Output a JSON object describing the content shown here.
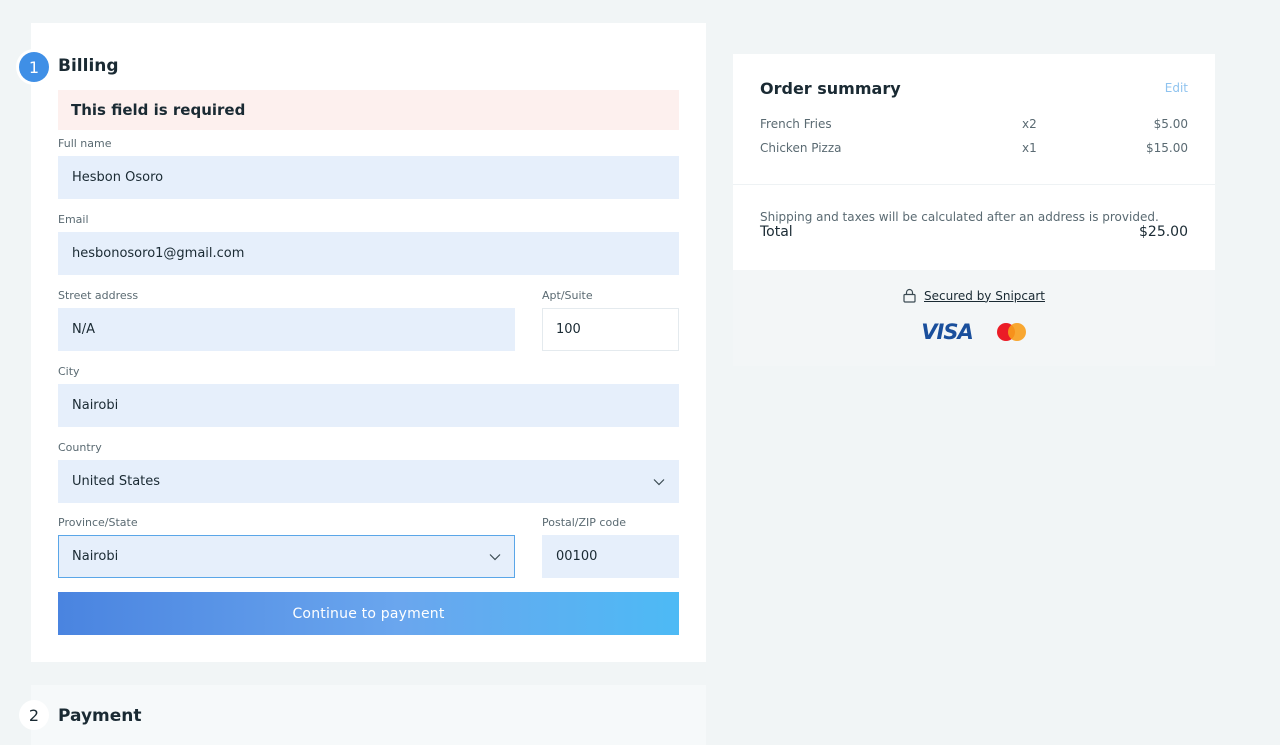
{
  "billing": {
    "step_number": "1",
    "title": "Billing",
    "error": "This field is required",
    "fields": {
      "full_name": {
        "label": "Full name",
        "value": "Hesbon Osoro"
      },
      "email": {
        "label": "Email",
        "value": "hesbonosoro1@gmail.com"
      },
      "street": {
        "label": "Street address",
        "value": "N/A"
      },
      "apt": {
        "label": "Apt/Suite",
        "value": "100"
      },
      "city": {
        "label": "City",
        "value": "Nairobi"
      },
      "country": {
        "label": "Country",
        "value": "United States"
      },
      "province": {
        "label": "Province/State",
        "value": "Nairobi"
      },
      "postal": {
        "label": "Postal/ZIP code",
        "value": "00100"
      }
    },
    "continue_label": "Continue to payment"
  },
  "payment": {
    "step_number": "2",
    "title": "Payment"
  },
  "summary": {
    "title": "Order summary",
    "edit_label": "Edit",
    "items": [
      {
        "name": "French Fries",
        "qty": "x2",
        "price": "$5.00"
      },
      {
        "name": "Chicken Pizza",
        "qty": "x1",
        "price": "$15.00"
      }
    ],
    "shipping_note": "Shipping and taxes will be calculated after an address is provided.",
    "total_label": "Total",
    "total_value": "$25.00",
    "secured_label": "Secured by Snipcart",
    "visa_label": "VISA"
  },
  "colors": {
    "primary": "#3f8fe6",
    "field_bg": "#e6effb",
    "error_bg": "#fdf0ee",
    "page_bg": "#f1f5f6"
  }
}
